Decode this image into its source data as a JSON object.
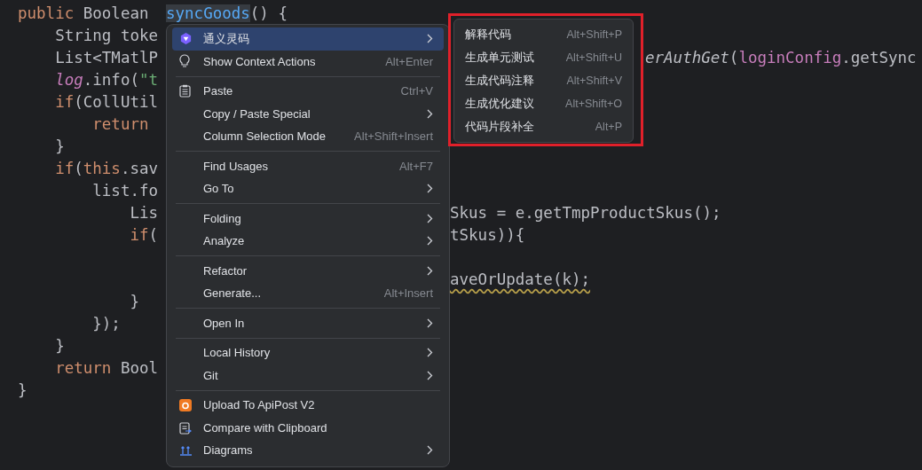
{
  "editor": {
    "lines": [
      {
        "left": [
          {
            "t": "public ",
            "kind": "kw"
          },
          {
            "t": "Boolean ",
            "kind": "plain"
          }
        ],
        "mid": [
          {
            "t": "syncGoods",
            "kind": "decl"
          },
          {
            "t": "() {",
            "kind": "plain"
          }
        ]
      },
      {
        "left": [
          {
            "t": "    String toke",
            "kind": "plain"
          }
        ]
      },
      {
        "left": [
          {
            "t": "    List<TMatlP",
            "kind": "plain"
          }
        ],
        "far": [
          {
            "t": "erAuthGet",
            "kind": "static"
          },
          {
            "t": "(",
            "kind": "plain"
          },
          {
            "t": "loginConfig",
            "kind": "field"
          },
          {
            "t": ".getSync",
            "kind": "plain"
          }
        ]
      },
      {
        "left": [
          {
            "t": "    log",
            "kind": "staticfield"
          },
          {
            "t": ".info(",
            "kind": "plain"
          },
          {
            "t": "\"t",
            "kind": "string"
          }
        ]
      },
      {
        "left": [
          {
            "t": "    if",
            "kind": "kw"
          },
          {
            "t": "(CollUtil",
            "kind": "plain"
          }
        ]
      },
      {
        "left": [
          {
            "t": "        return ",
            "kind": "kw"
          }
        ]
      },
      {
        "left": [
          {
            "t": "    }",
            "kind": "plain"
          }
        ]
      },
      {
        "left": [
          {
            "t": "    if",
            "kind": "kw"
          },
          {
            "t": "(",
            "kind": "plain"
          },
          {
            "t": "this",
            "kind": "kw"
          },
          {
            "t": ".sav",
            "kind": "plain"
          }
        ]
      },
      {
        "left": [
          {
            "t": "        list.fo",
            "kind": "plain"
          }
        ]
      },
      {
        "left": [
          {
            "t": "            Lis",
            "kind": "plain"
          }
        ],
        "right": [
          {
            "t": "Skus = e.getTmpProductSkus();",
            "kind": "plain"
          }
        ]
      },
      {
        "left": [
          {
            "t": "            if",
            "kind": "kw"
          },
          {
            "t": "(",
            "kind": "plain"
          }
        ],
        "right": [
          {
            "t": "tSkus)){",
            "kind": "plain"
          }
        ]
      },
      {
        "right": [
          {
            "t": "aveOrUpdate(k);",
            "kind": "warn"
          }
        ]
      },
      {
        "left": [
          {
            "t": "            }",
            "kind": "plain"
          }
        ]
      },
      {
        "left": [
          {
            "t": "        });",
            "kind": "plain"
          }
        ]
      },
      {
        "left": [
          {
            "t": "    }",
            "kind": "plain"
          }
        ]
      },
      {
        "left": [
          {
            "t": "    return ",
            "kind": "kw"
          },
          {
            "t": "Bool",
            "kind": "plain"
          }
        ]
      },
      {
        "left": [
          {
            "t": "}",
            "kind": "plain"
          }
        ]
      }
    ]
  },
  "context_menu": {
    "items": [
      {
        "kind": "item",
        "label": "通义灵码",
        "submenu": true,
        "selected": true
      },
      {
        "kind": "item",
        "label": "Show Context Actions",
        "shortcut": "Alt+Enter",
        "submenu": false,
        "selected": false
      },
      {
        "kind": "separator"
      },
      {
        "kind": "item",
        "label": "Paste",
        "shortcut": "Ctrl+V",
        "submenu": false,
        "selected": false
      },
      {
        "kind": "item",
        "label": "Copy / Paste Special",
        "submenu": true,
        "selected": false
      },
      {
        "kind": "item",
        "label": "Column Selection Mode",
        "shortcut": "Alt+Shift+Insert",
        "submenu": false,
        "selected": false
      },
      {
        "kind": "separator"
      },
      {
        "kind": "item",
        "label": "Find Usages",
        "shortcut": "Alt+F7",
        "submenu": false,
        "selected": false
      },
      {
        "kind": "item",
        "label": "Go To",
        "submenu": true,
        "selected": false
      },
      {
        "kind": "separator"
      },
      {
        "kind": "item",
        "label": "Folding",
        "submenu": true,
        "selected": false
      },
      {
        "kind": "item",
        "label": "Analyze",
        "submenu": true,
        "selected": false
      },
      {
        "kind": "separator"
      },
      {
        "kind": "item",
        "label": "Refactor",
        "submenu": true,
        "selected": false
      },
      {
        "kind": "item",
        "label": "Generate...",
        "shortcut": "Alt+Insert",
        "submenu": false,
        "selected": false
      },
      {
        "kind": "separator"
      },
      {
        "kind": "item",
        "label": "Open In",
        "submenu": true,
        "selected": false
      },
      {
        "kind": "separator"
      },
      {
        "kind": "item",
        "label": "Local History",
        "submenu": true,
        "selected": false
      },
      {
        "kind": "item",
        "label": "Git",
        "submenu": true,
        "selected": false
      },
      {
        "kind": "separator"
      },
      {
        "kind": "item",
        "label": "Upload To ApiPost V2",
        "submenu": false,
        "selected": false
      },
      {
        "kind": "item",
        "label": "Compare with Clipboard",
        "submenu": false,
        "selected": false
      },
      {
        "kind": "item",
        "label": "Diagrams",
        "submenu": true,
        "selected": false
      }
    ]
  },
  "submenu": {
    "items": [
      {
        "label": "解释代码",
        "shortcut": "Alt+Shift+P"
      },
      {
        "label": "生成单元测试",
        "shortcut": "Alt+Shift+U"
      },
      {
        "label": "生成代码注释",
        "shortcut": "Alt+Shift+V"
      },
      {
        "label": "生成优化建议",
        "shortcut": "Alt+Shift+O"
      },
      {
        "label": "代码片段补全",
        "shortcut": "Alt+P"
      }
    ]
  }
}
